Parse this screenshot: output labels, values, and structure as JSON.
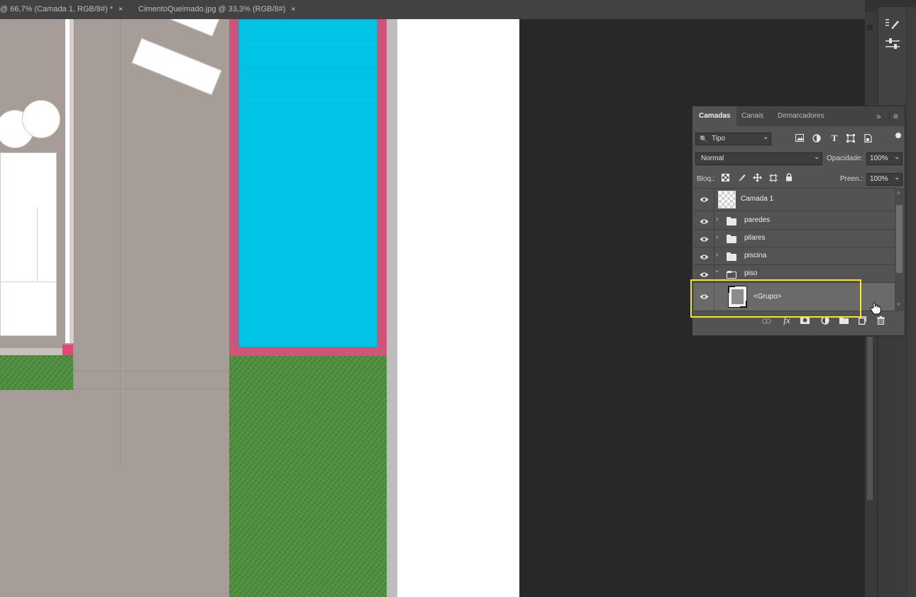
{
  "tabs": [
    {
      "label": "@ 66,7% (Camada 1, RGB/8#) *",
      "close": "×",
      "active": true
    },
    {
      "label": "CimentoQueimado.jpg @ 33,3% (RGB/8#)",
      "close": "×",
      "active": false
    }
  ],
  "collapse_glyph": "«",
  "layers_panel": {
    "tabs": [
      "Camadas",
      "Canais",
      "Demarcadores"
    ],
    "panel_menu_glyphs": {
      "expand": "»",
      "menu": "≡"
    },
    "filter": {
      "search_glyph": "🔍",
      "label": "Tipo",
      "chevron": "⌄"
    },
    "blend_mode": {
      "value": "Normal",
      "chevron": "⌄"
    },
    "opacity": {
      "label": "Opacidade:",
      "value": "100%",
      "chevron": "⌄"
    },
    "lock": {
      "label": "Bloq.:"
    },
    "fill": {
      "label": "Preen.:",
      "value": "100%",
      "chevron": "⌄"
    },
    "layers": [
      {
        "name": "Camada 1",
        "type": "layer",
        "visible": true
      },
      {
        "name": "paredes",
        "type": "group",
        "expanded": false,
        "visible": true
      },
      {
        "name": "pilares",
        "type": "group",
        "expanded": false,
        "visible": true
      },
      {
        "name": "piscina",
        "type": "group",
        "expanded": false,
        "visible": true
      },
      {
        "name": "piso",
        "type": "group",
        "expanded": true,
        "visible": true
      },
      {
        "name": "<Grupo>",
        "type": "smart-object",
        "visible": true,
        "selected": true,
        "highlighted": true
      }
    ],
    "footer_icons": [
      "link-icon",
      "fx-icon",
      "mask-icon",
      "adjustment-icon",
      "new-group-icon",
      "new-layer-icon",
      "trash-icon"
    ]
  },
  "right_toolbar_icons": [
    "brush-presets-icon",
    "adjustments-sliders-icon"
  ],
  "colors": {
    "accent_highlight": "#f5ea14",
    "pool_water": "#00c3e6",
    "pool_border": "#cc5579",
    "floor": "#a69d99",
    "grass": "#4d8e3d",
    "panel_bg": "#535353",
    "app_bg": "#282828"
  }
}
